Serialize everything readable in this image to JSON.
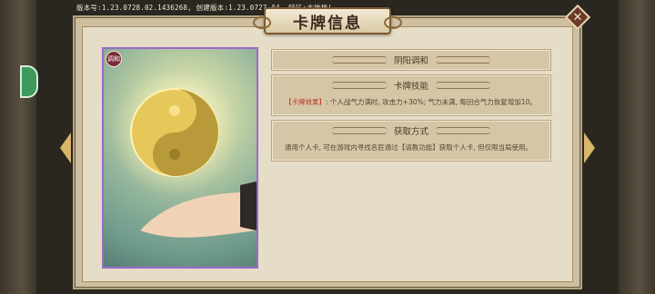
{
  "version_info": "版本号:1.23.0728.02.1436268, 创建版本:1.23.0727.04, 特征:本地档!",
  "title": "卡牌信息",
  "card": {
    "badge": "调和"
  },
  "sections": [
    {
      "title": "阴阳调和"
    },
    {
      "title": "卡牌技能",
      "body_highlight": "【卡牌效果】",
      "body_text": ": 个人战气力满时, 攻击力+30%; 气力未满, 每回合气力恢复增加10。"
    },
    {
      "title": "获取方式",
      "body_text": "通用个人卡, 可在游戏内寻找名匠通过【请教功能】获取个人卡, 但仅限当局使用。"
    }
  ],
  "icons": {
    "close": "close-icon",
    "left_arrow": "chevron-left-icon",
    "right_arrow": "chevron-right-icon"
  }
}
